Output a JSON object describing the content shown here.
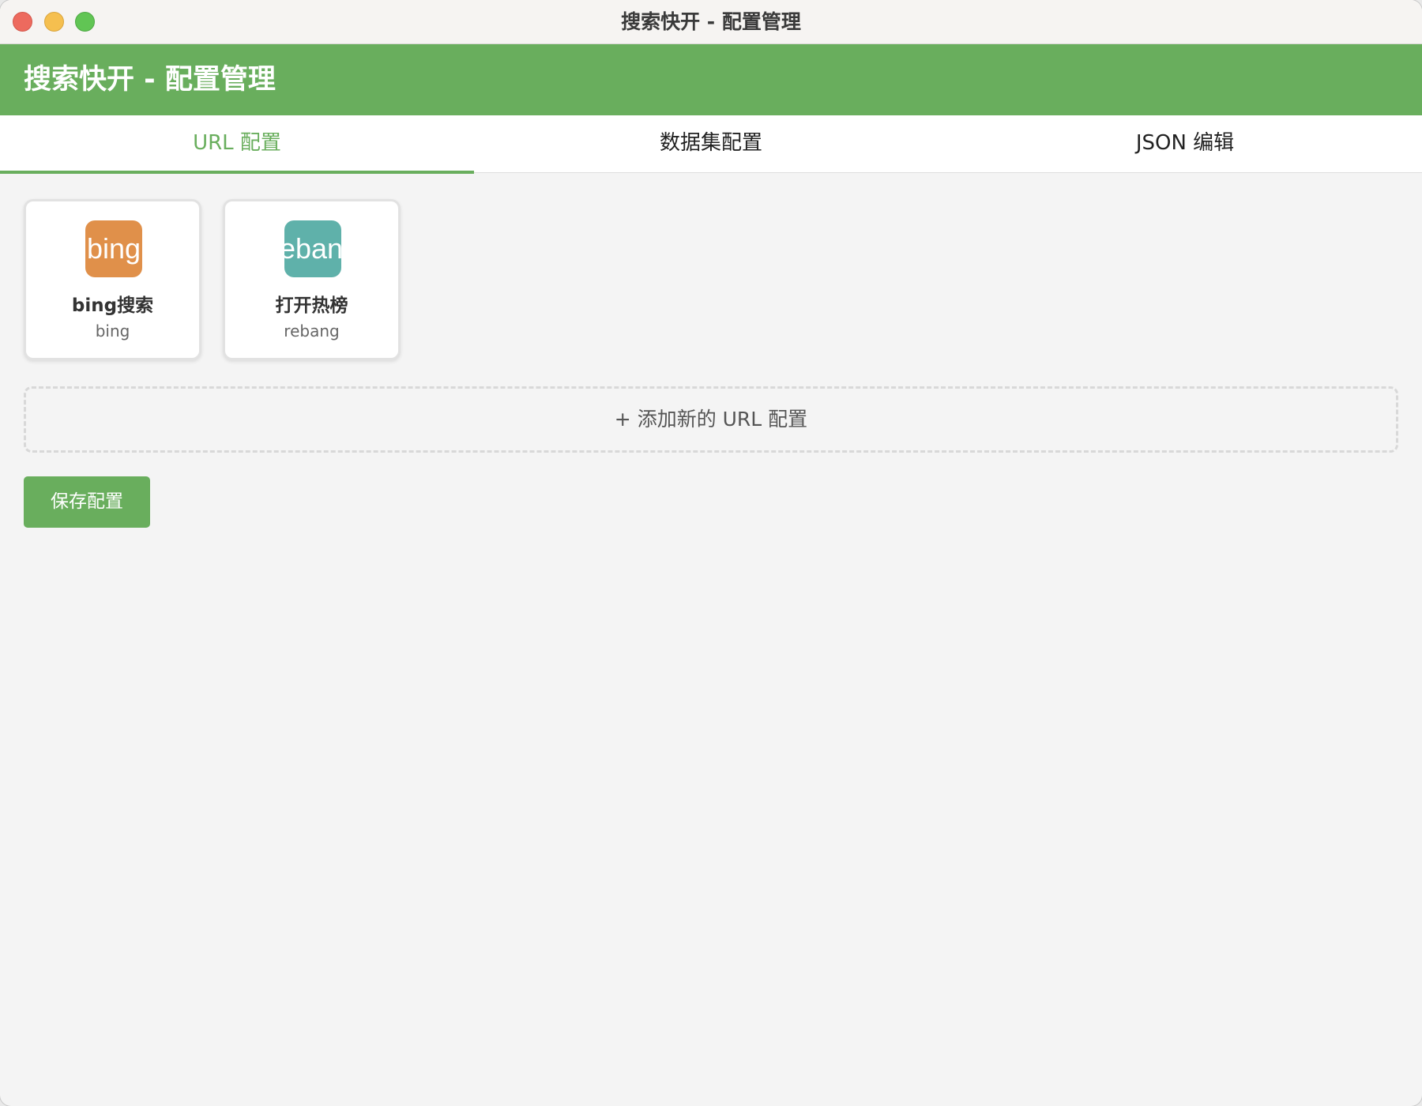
{
  "window": {
    "title": "搜索快开 - 配置管理"
  },
  "header": {
    "title": "搜索快开 - 配置管理"
  },
  "tabs": [
    {
      "label": "URL 配置",
      "active": true
    },
    {
      "label": "数据集配置",
      "active": false
    },
    {
      "label": "JSON 编辑",
      "active": false
    }
  ],
  "cards": [
    {
      "icon_text": "bing",
      "icon_color": "#e0904a",
      "name": "bing搜索",
      "key": "bing"
    },
    {
      "icon_text": "reban",
      "icon_color": "#5fb1aa",
      "name": "打开热榜",
      "key": "rebang"
    }
  ],
  "add_url_label": "+ 添加新的 URL 配置",
  "save_label": "保存配置",
  "colors": {
    "accent": "#69ae5d"
  }
}
